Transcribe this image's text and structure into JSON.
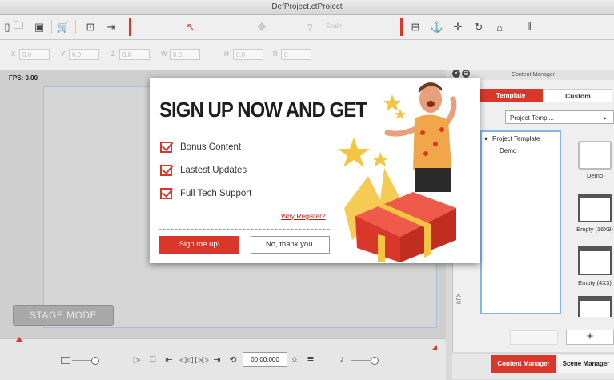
{
  "window": {
    "title": "DefProject.ctProject"
  },
  "toolbar": {
    "scale_label": "Scale"
  },
  "transform": {
    "fields": [
      {
        "label": "X",
        "value": "0.0"
      },
      {
        "label": "Y",
        "value": "0.0"
      },
      {
        "label": "Z",
        "value": "0.0"
      },
      {
        "label": "W",
        "value": "0.0"
      },
      {
        "label": "H",
        "value": "0.0"
      },
      {
        "label": "R",
        "value": "0"
      }
    ]
  },
  "stage": {
    "fps": "FPS: 0.00",
    "mode_button": "STAGE MODE"
  },
  "timeline": {
    "timecode": "00:00:000"
  },
  "content_manager": {
    "header": "Content Manager",
    "tabs": [
      "Template",
      "Custom"
    ],
    "path": "Project Templ...",
    "tree": [
      "Project Template",
      "Demo"
    ],
    "thumbnails": [
      "Demo",
      "Empty (16X9)",
      "Empty (4X3)"
    ],
    "sfx_label": "SFX",
    "add_label": "+"
  },
  "bottom_tabs": [
    "Content Manager",
    "Scene Manager"
  ],
  "popup": {
    "title": "SIGN UP NOW AND GET",
    "benefits": [
      "Bonus Content",
      "Lastest Updates",
      "Full Tech Support"
    ],
    "why_link": "Why Register?",
    "primary_button": "Sign me up!",
    "secondary_button": "No, thank you.",
    "close_glyph": "×",
    "min_glyph": "⊖"
  },
  "colors": {
    "accent": "#d9372a",
    "selection": "#86b4e6"
  }
}
